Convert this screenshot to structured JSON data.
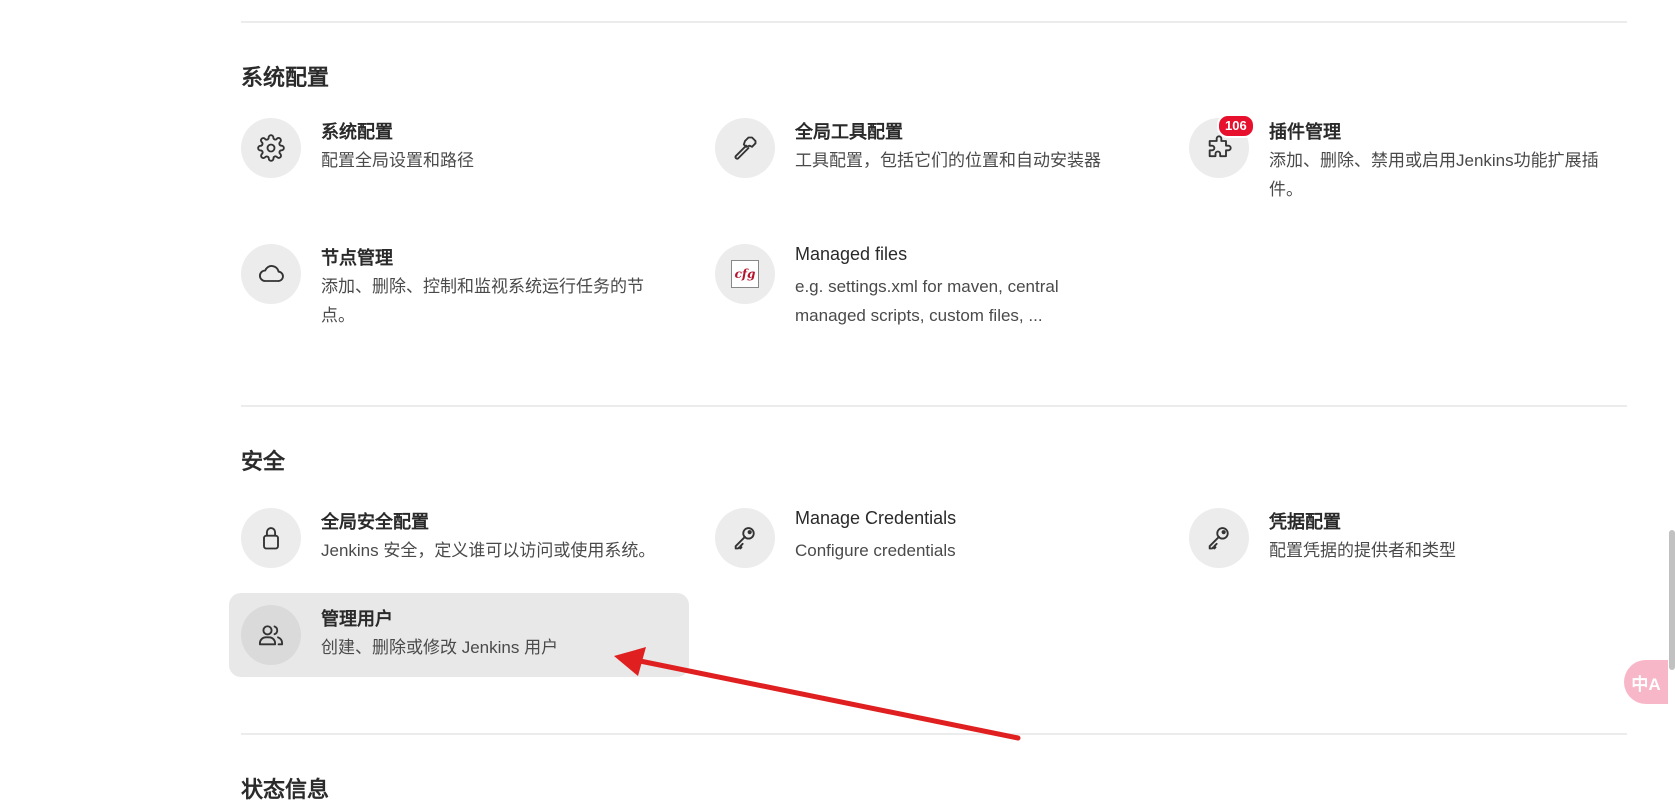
{
  "sections": {
    "system": {
      "title": "系统配置",
      "items": [
        {
          "title": "系统配置",
          "desc": "配置全局设置和路径",
          "icon": "gear-icon"
        },
        {
          "title": "全局工具配置",
          "desc": "工具配置，包括它们的位置和自动安装器",
          "icon": "hammer-icon"
        },
        {
          "title": "插件管理",
          "desc": "添加、删除、禁用或启用Jenkins功能扩展插件。",
          "icon": "puzzle-icon",
          "badge": "106"
        },
        {
          "title": "节点管理",
          "desc": "添加、删除、控制和监视系统运行任务的节点。",
          "icon": "cloud-icon"
        },
        {
          "title": "Managed files",
          "desc": "e.g. settings.xml for maven, central managed scripts, custom files, ...",
          "icon": "cfg-file-icon",
          "icon_text": "cfg"
        }
      ]
    },
    "security": {
      "title": "安全",
      "items": [
        {
          "title": "全局安全配置",
          "desc": "Jenkins 安全，定义谁可以访问或使用系统。",
          "icon": "lock-icon"
        },
        {
          "title": "Manage Credentials",
          "desc": "Configure credentials",
          "icon": "key-icon"
        },
        {
          "title": "凭据配置",
          "desc": "配置凭据的提供者和类型",
          "icon": "key-icon"
        },
        {
          "title": "管理用户",
          "desc": "创建、删除或修改 Jenkins 用户",
          "icon": "users-icon"
        }
      ]
    },
    "status": {
      "title": "状态信息"
    }
  },
  "translate_button": {
    "label": "中A"
  },
  "colors": {
    "badge": "#e7112d",
    "arrow": "#e02020",
    "highlight_bg": "#e8e8e8"
  }
}
